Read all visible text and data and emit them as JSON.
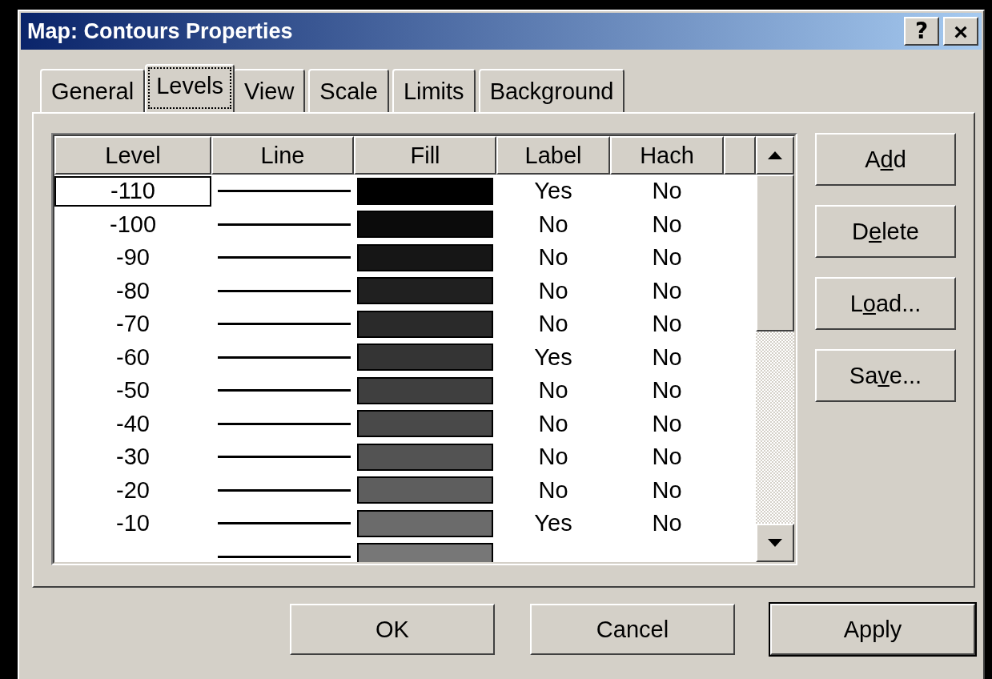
{
  "window": {
    "title": "Map: Contours Properties",
    "title_buttons": [
      {
        "kind": "help",
        "label": "?"
      },
      {
        "kind": "close",
        "label": "×"
      }
    ]
  },
  "tabs": [
    {
      "label": "General",
      "selected": false
    },
    {
      "label": "Levels",
      "selected": true
    },
    {
      "label": "View",
      "selected": false
    },
    {
      "label": "Scale",
      "selected": false
    },
    {
      "label": "Limits",
      "selected": false
    },
    {
      "label": "Background",
      "selected": false
    }
  ],
  "table": {
    "columns": [
      "Level",
      "Line",
      "Fill",
      "Label",
      "Hach"
    ],
    "rows": [
      {
        "level": "-110",
        "color": "#000000",
        "label": "Yes",
        "hach": "No",
        "focused": true
      },
      {
        "level": "-100",
        "color": "#0b0b0b",
        "label": "No",
        "hach": "No",
        "focused": false
      },
      {
        "level": "-90",
        "color": "#161616",
        "label": "No",
        "hach": "No",
        "focused": false
      },
      {
        "level": "-80",
        "color": "#202020",
        "label": "No",
        "hach": "No",
        "focused": false
      },
      {
        "level": "-70",
        "color": "#2a2a2a",
        "label": "No",
        "hach": "No",
        "focused": false
      },
      {
        "level": "-60",
        "color": "#343434",
        "label": "Yes",
        "hach": "No",
        "focused": false
      },
      {
        "level": "-50",
        "color": "#3f3f3f",
        "label": "No",
        "hach": "No",
        "focused": false
      },
      {
        "level": "-40",
        "color": "#494949",
        "label": "No",
        "hach": "No",
        "focused": false
      },
      {
        "level": "-30",
        "color": "#535353",
        "label": "No",
        "hach": "No",
        "focused": false
      },
      {
        "level": "-20",
        "color": "#5e5e5e",
        "label": "No",
        "hach": "No",
        "focused": false
      },
      {
        "level": "-10",
        "color": "#6b6b6b",
        "label": "Yes",
        "hach": "No",
        "focused": false
      },
      {
        "color": "#777777",
        "focused": false
      }
    ]
  },
  "side_buttons": [
    {
      "label_parts": [
        "A",
        "d",
        "d"
      ]
    },
    {
      "label_parts": [
        "D",
        "e",
        "lete"
      ]
    },
    {
      "label_parts": [
        "L",
        "o",
        "ad..."
      ]
    },
    {
      "label_parts": [
        "Sa",
        "v",
        "e..."
      ]
    }
  ],
  "footer_buttons": [
    {
      "label": "OK",
      "default": false
    },
    {
      "label": "Cancel",
      "default": false
    },
    {
      "label": "Apply",
      "default": true
    }
  ]
}
